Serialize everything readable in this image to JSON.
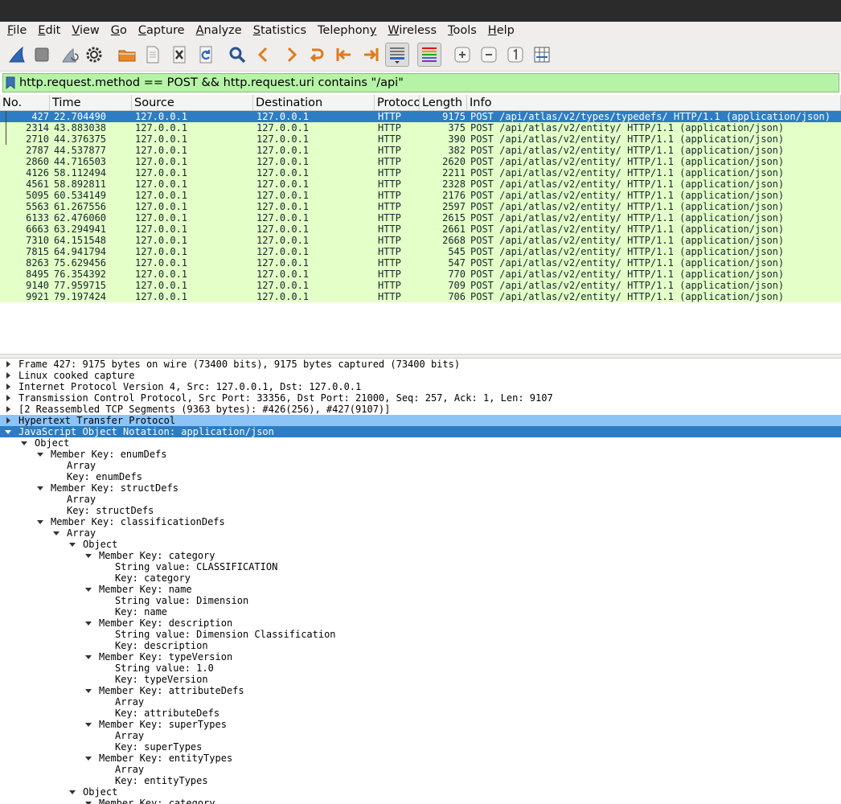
{
  "menu": [
    {
      "key": "F",
      "rest": "ile"
    },
    {
      "key": "E",
      "rest": "dit"
    },
    {
      "key": "V",
      "rest": "iew"
    },
    {
      "key": "G",
      "rest": "o"
    },
    {
      "key": "C",
      "rest": "apture"
    },
    {
      "key": "A",
      "rest": "nalyze"
    },
    {
      "key": "S",
      "rest": "tatistics"
    },
    {
      "key": "y",
      "pre": "Telephon",
      "rest": ""
    },
    {
      "key": "W",
      "rest": "ireless"
    },
    {
      "key": "T",
      "rest": "ools"
    },
    {
      "key": "H",
      "rest": "elp"
    }
  ],
  "toolbar": {
    "icons": [
      "shark-fin-icon",
      "stop-icon",
      "restart-icon",
      "options-gear-icon",
      "open-folder-icon",
      "file-icon",
      "close-file-icon",
      "reload-icon",
      "search-icon",
      "go-back-icon",
      "go-forward-icon",
      "jump-to-icon",
      "first-packet-icon",
      "last-packet-icon",
      "autoscroll-icon",
      "colorize-icon",
      "zoom-in-icon",
      "zoom-out-icon",
      "normal-size-icon",
      "resize-columns-icon"
    ]
  },
  "filter": {
    "text": "http.request.method == POST && http.request.uri contains \"/api\""
  },
  "packet_list": {
    "columns": [
      "No.",
      "Time",
      "Source",
      "Destination",
      "Protoco",
      "Length",
      "Info"
    ],
    "rows": [
      {
        "no": "427",
        "time": "22.704490",
        "src": "127.0.0.1",
        "dst": "127.0.0.1",
        "proto": "HTTP",
        "len": "9175",
        "info": "POST /api/atlas/v2/types/typedefs/ HTTP/1.1  (application/json)",
        "selected": true
      },
      {
        "no": "2314",
        "time": "43.883038",
        "src": "127.0.0.1",
        "dst": "127.0.0.1",
        "proto": "HTTP",
        "len": "375",
        "info": "POST /api/atlas/v2/entity/ HTTP/1.1  (application/json)"
      },
      {
        "no": "2710",
        "time": "44.376375",
        "src": "127.0.0.1",
        "dst": "127.0.0.1",
        "proto": "HTTP",
        "len": "390",
        "info": "POST /api/atlas/v2/entity/ HTTP/1.1  (application/json)"
      },
      {
        "no": "2787",
        "time": "44.537877",
        "src": "127.0.0.1",
        "dst": "127.0.0.1",
        "proto": "HTTP",
        "len": "382",
        "info": "POST /api/atlas/v2/entity/ HTTP/1.1  (application/json)"
      },
      {
        "no": "2860",
        "time": "44.716503",
        "src": "127.0.0.1",
        "dst": "127.0.0.1",
        "proto": "HTTP",
        "len": "2620",
        "info": "POST /api/atlas/v2/entity/ HTTP/1.1  (application/json)"
      },
      {
        "no": "4126",
        "time": "58.112494",
        "src": "127.0.0.1",
        "dst": "127.0.0.1",
        "proto": "HTTP",
        "len": "2211",
        "info": "POST /api/atlas/v2/entity/ HTTP/1.1  (application/json)"
      },
      {
        "no": "4561",
        "time": "58.892811",
        "src": "127.0.0.1",
        "dst": "127.0.0.1",
        "proto": "HTTP",
        "len": "2328",
        "info": "POST /api/atlas/v2/entity/ HTTP/1.1  (application/json)"
      },
      {
        "no": "5095",
        "time": "60.534149",
        "src": "127.0.0.1",
        "dst": "127.0.0.1",
        "proto": "HTTP",
        "len": "2176",
        "info": "POST /api/atlas/v2/entity/ HTTP/1.1  (application/json)"
      },
      {
        "no": "5563",
        "time": "61.267556",
        "src": "127.0.0.1",
        "dst": "127.0.0.1",
        "proto": "HTTP",
        "len": "2597",
        "info": "POST /api/atlas/v2/entity/ HTTP/1.1  (application/json)"
      },
      {
        "no": "6133",
        "time": "62.476060",
        "src": "127.0.0.1",
        "dst": "127.0.0.1",
        "proto": "HTTP",
        "len": "2615",
        "info": "POST /api/atlas/v2/entity/ HTTP/1.1  (application/json)"
      },
      {
        "no": "6663",
        "time": "63.294941",
        "src": "127.0.0.1",
        "dst": "127.0.0.1",
        "proto": "HTTP",
        "len": "2661",
        "info": "POST /api/atlas/v2/entity/ HTTP/1.1  (application/json)"
      },
      {
        "no": "7310",
        "time": "64.151548",
        "src": "127.0.0.1",
        "dst": "127.0.0.1",
        "proto": "HTTP",
        "len": "2668",
        "info": "POST /api/atlas/v2/entity/ HTTP/1.1  (application/json)"
      },
      {
        "no": "7815",
        "time": "64.941794",
        "src": "127.0.0.1",
        "dst": "127.0.0.1",
        "proto": "HTTP",
        "len": "545",
        "info": "POST /api/atlas/v2/entity/ HTTP/1.1  (application/json)"
      },
      {
        "no": "8263",
        "time": "75.629456",
        "src": "127.0.0.1",
        "dst": "127.0.0.1",
        "proto": "HTTP",
        "len": "547",
        "info": "POST /api/atlas/v2/entity/ HTTP/1.1  (application/json)"
      },
      {
        "no": "8495",
        "time": "76.354392",
        "src": "127.0.0.1",
        "dst": "127.0.0.1",
        "proto": "HTTP",
        "len": "770",
        "info": "POST /api/atlas/v2/entity/ HTTP/1.1  (application/json)"
      },
      {
        "no": "9140",
        "time": "77.959715",
        "src": "127.0.0.1",
        "dst": "127.0.0.1",
        "proto": "HTTP",
        "len": "709",
        "info": "POST /api/atlas/v2/entity/ HTTP/1.1  (application/json)"
      },
      {
        "no": "9921",
        "time": "79.197424",
        "src": "127.0.0.1",
        "dst": "127.0.0.1",
        "proto": "HTTP",
        "len": "706",
        "info": "POST /api/atlas/v2/entity/ HTTP/1.1  (application/json)"
      }
    ]
  },
  "details": [
    {
      "depth": 0,
      "state": "collapsed",
      "text": "Frame 427: 9175 bytes on wire (73400 bits), 9175 bytes captured (73400 bits)"
    },
    {
      "depth": 0,
      "state": "collapsed",
      "text": "Linux cooked capture"
    },
    {
      "depth": 0,
      "state": "collapsed",
      "text": "Internet Protocol Version 4, Src: 127.0.0.1, Dst: 127.0.0.1"
    },
    {
      "depth": 0,
      "state": "collapsed",
      "text": "Transmission Control Protocol, Src Port: 33356, Dst Port: 21000, Seq: 257, Ack: 1, Len: 9107"
    },
    {
      "depth": 0,
      "state": "collapsed",
      "text": "[2 Reassembled TCP Segments (9363 bytes): #426(256), #427(9107)]"
    },
    {
      "depth": 0,
      "state": "collapsed",
      "text": "Hypertext Transfer Protocol",
      "hl": "light"
    },
    {
      "depth": 0,
      "state": "expanded",
      "text": "JavaScript Object Notation: application/json",
      "hl": "dark"
    },
    {
      "depth": 1,
      "state": "expanded",
      "text": "Object"
    },
    {
      "depth": 2,
      "state": "expanded",
      "text": "Member Key: enumDefs"
    },
    {
      "depth": 3,
      "state": "none",
      "text": "Array"
    },
    {
      "depth": 3,
      "state": "none",
      "text": "Key: enumDefs"
    },
    {
      "depth": 2,
      "state": "expanded",
      "text": "Member Key: structDefs"
    },
    {
      "depth": 3,
      "state": "none",
      "text": "Array"
    },
    {
      "depth": 3,
      "state": "none",
      "text": "Key: structDefs"
    },
    {
      "depth": 2,
      "state": "expanded",
      "text": "Member Key: classificationDefs"
    },
    {
      "depth": 3,
      "state": "expanded",
      "text": "Array"
    },
    {
      "depth": 4,
      "state": "expanded",
      "text": "Object"
    },
    {
      "depth": 5,
      "state": "expanded",
      "text": "Member Key: category"
    },
    {
      "depth": 6,
      "state": "none",
      "text": "String value: CLASSIFICATION"
    },
    {
      "depth": 6,
      "state": "none",
      "text": "Key: category"
    },
    {
      "depth": 5,
      "state": "expanded",
      "text": "Member Key: name"
    },
    {
      "depth": 6,
      "state": "none",
      "text": "String value: Dimension"
    },
    {
      "depth": 6,
      "state": "none",
      "text": "Key: name"
    },
    {
      "depth": 5,
      "state": "expanded",
      "text": "Member Key: description"
    },
    {
      "depth": 6,
      "state": "none",
      "text": "String value: Dimension Classification"
    },
    {
      "depth": 6,
      "state": "none",
      "text": "Key: description"
    },
    {
      "depth": 5,
      "state": "expanded",
      "text": "Member Key: typeVersion"
    },
    {
      "depth": 6,
      "state": "none",
      "text": "String value: 1.0"
    },
    {
      "depth": 6,
      "state": "none",
      "text": "Key: typeVersion"
    },
    {
      "depth": 5,
      "state": "expanded",
      "text": "Member Key: attributeDefs"
    },
    {
      "depth": 6,
      "state": "none",
      "text": "Array"
    },
    {
      "depth": 6,
      "state": "none",
      "text": "Key: attributeDefs"
    },
    {
      "depth": 5,
      "state": "expanded",
      "text": "Member Key: superTypes"
    },
    {
      "depth": 6,
      "state": "none",
      "text": "Array"
    },
    {
      "depth": 6,
      "state": "none",
      "text": "Key: superTypes"
    },
    {
      "depth": 5,
      "state": "expanded",
      "text": "Member Key: entityTypes"
    },
    {
      "depth": 6,
      "state": "none",
      "text": "Array"
    },
    {
      "depth": 6,
      "state": "none",
      "text": "Key: entityTypes"
    },
    {
      "depth": 4,
      "state": "expanded",
      "text": "Object"
    },
    {
      "depth": 5,
      "state": "expanded",
      "text": "Member Key: category"
    }
  ],
  "colors": {
    "selected": "#2c7dc3",
    "row_bg": "#e4ffc7",
    "filter_bg": "#b7f3a7",
    "highlight_light": "#8cc4f7"
  }
}
